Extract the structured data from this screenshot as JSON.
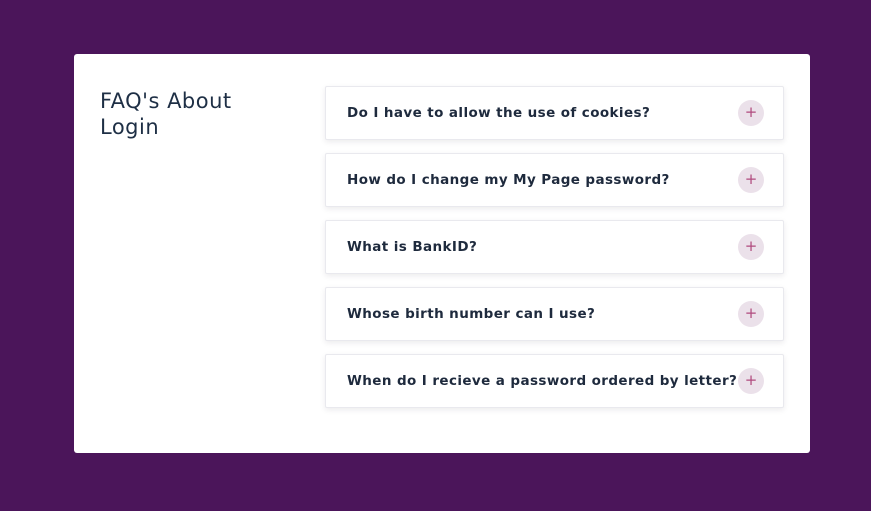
{
  "page": {
    "title": "FAQ's About Login"
  },
  "faq": {
    "items": [
      {
        "question": "Do I have to allow the use of cookies?",
        "toggle": "+"
      },
      {
        "question": "How do I change my My Page password?",
        "toggle": "+"
      },
      {
        "question": "What is BankID?",
        "toggle": "+"
      },
      {
        "question": "Whose birth number can I use?",
        "toggle": "+"
      },
      {
        "question": "When do I recieve a password ordered by letter?",
        "toggle": "+"
      }
    ]
  },
  "colors": {
    "background": "#4b155a",
    "card": "#ffffff",
    "heading_text": "#1e2f45",
    "question_text": "#1e2a3d",
    "toggle_bg": "#ebe1ea",
    "toggle_icon": "#b04a7e"
  },
  "icons": {
    "toggle": "plus-icon"
  }
}
